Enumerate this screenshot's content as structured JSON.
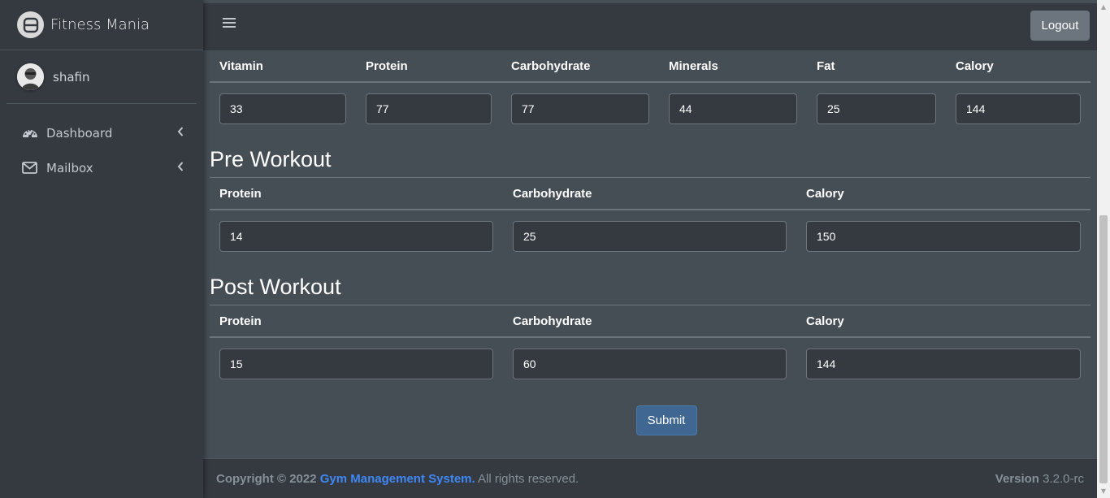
{
  "brand": {
    "name": "Fitness Mania",
    "logo_icon": "fitness-logo-icon"
  },
  "user": {
    "name": "shafin"
  },
  "sidebar": {
    "items": [
      {
        "label": "Dashboard",
        "icon": "tachometer-icon"
      },
      {
        "label": "Mailbox",
        "icon": "envelope-icon"
      }
    ]
  },
  "topbar": {
    "logout_label": "Logout"
  },
  "nutrition": {
    "headers": [
      "Vitamin",
      "Protein",
      "Carbohydrate",
      "Minerals",
      "Fat",
      "Calory"
    ],
    "values": [
      "33",
      "77",
      "77",
      "44",
      "25",
      "144"
    ]
  },
  "pre_workout": {
    "title": "Pre Workout",
    "headers": [
      "Protein",
      "Carbohydrate",
      "Calory"
    ],
    "values": [
      "14",
      "25",
      "150"
    ]
  },
  "post_workout": {
    "title": "Post Workout",
    "headers": [
      "Protein",
      "Carbohydrate",
      "Calory"
    ],
    "values": [
      "15",
      "60",
      "144"
    ]
  },
  "form": {
    "submit_label": "Submit"
  },
  "footer": {
    "copyright_prefix": "Copyright © 2022",
    "link_text": "Gym Management System.",
    "rights": "All rights reserved.",
    "version_label": "Version",
    "version_number": "3.2.0-rc"
  },
  "colors": {
    "accent": "#3f87f5",
    "submit": "#3f6791",
    "sidebar": "#343a40",
    "content": "#454d55"
  }
}
